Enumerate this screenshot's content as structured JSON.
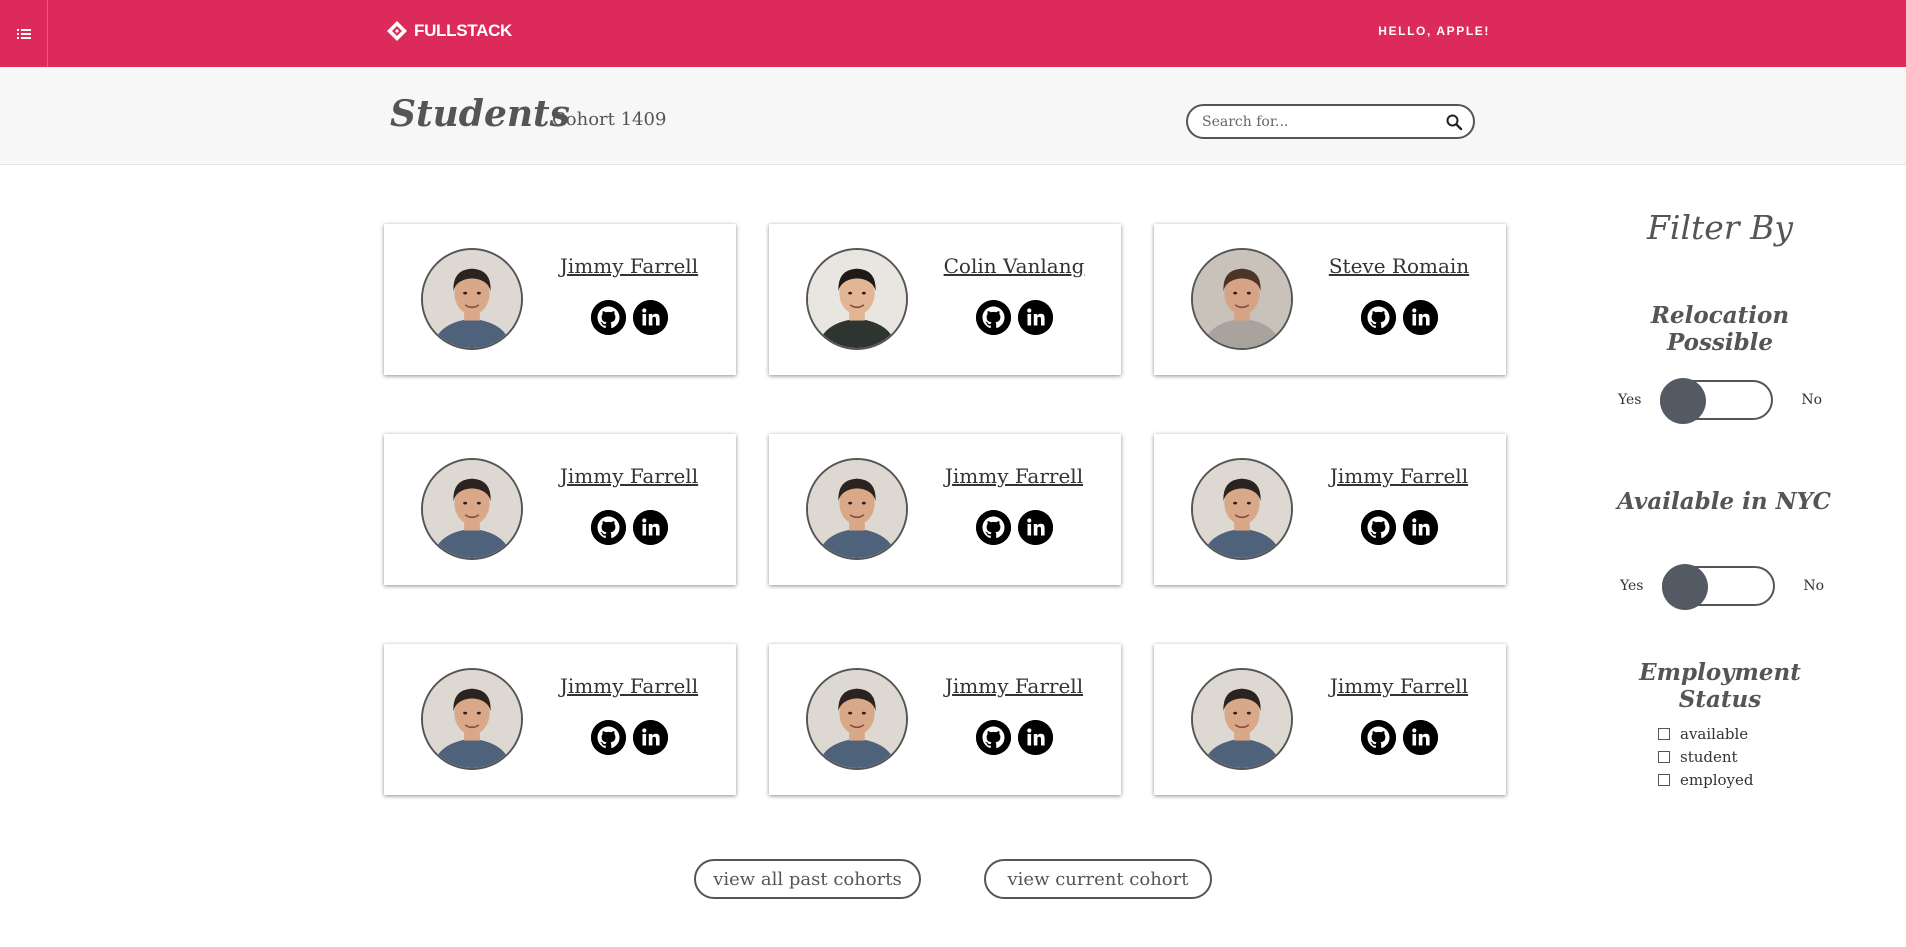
{
  "topbar": {
    "brand": "FULLSTACK",
    "greeting": "HELLO, APPLE!",
    "accent_color": "#dc2a5a",
    "menu_icon": "list-icon"
  },
  "header": {
    "title": "Students",
    "cohort": "Cohort 1409",
    "search": {
      "placeholder": "Search for...",
      "value": ""
    }
  },
  "students": [
    {
      "name": "Jimmy Farrell",
      "avatar": "jimmy"
    },
    {
      "name": "Colin Vanlang",
      "avatar": "colin"
    },
    {
      "name": "Steve Romain",
      "avatar": "steve"
    },
    {
      "name": "Jimmy Farrell",
      "avatar": "jimmy"
    },
    {
      "name": "Jimmy Farrell",
      "avatar": "jimmy"
    },
    {
      "name": "Jimmy Farrell",
      "avatar": "jimmy"
    },
    {
      "name": "Jimmy Farrell",
      "avatar": "jimmy"
    },
    {
      "name": "Jimmy Farrell",
      "avatar": "jimmy"
    },
    {
      "name": "Jimmy Farrell",
      "avatar": "jimmy"
    }
  ],
  "filter": {
    "title": "Filter By",
    "relocation": {
      "heading": "Relocation Possible",
      "yes": "Yes",
      "no": "No",
      "value": "Yes"
    },
    "nyc": {
      "heading": "Available in NYC",
      "yes": "Yes",
      "no": "No",
      "value": "Yes"
    },
    "employment": {
      "heading": "Employment Status",
      "options": [
        "available",
        "student",
        "employed"
      ]
    }
  },
  "buttons": {
    "past": "view all past cohorts",
    "current": "view current cohort"
  }
}
